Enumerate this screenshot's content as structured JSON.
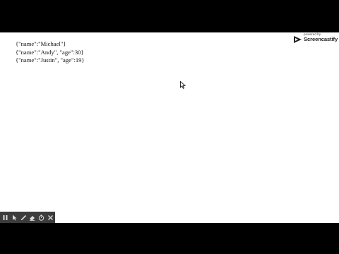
{
  "lines": [
    "{\"name\":\"Michael\"}",
    "{\"name\":\"Andy\", \"age\":30}",
    "{\"name\":\"Justin\", \"age\":19}"
  ],
  "watermark": {
    "small_text": "powered by",
    "brand_text": "Screencastify"
  },
  "toolbar": {
    "icons": [
      "pause-icon",
      "pointer-icon",
      "pen-icon",
      "eraser-icon",
      "timer-icon",
      "close-icon"
    ]
  },
  "colors": {
    "background": "#ffffff",
    "letterbox": "#000000",
    "toolbar": "#3c3c3c"
  }
}
